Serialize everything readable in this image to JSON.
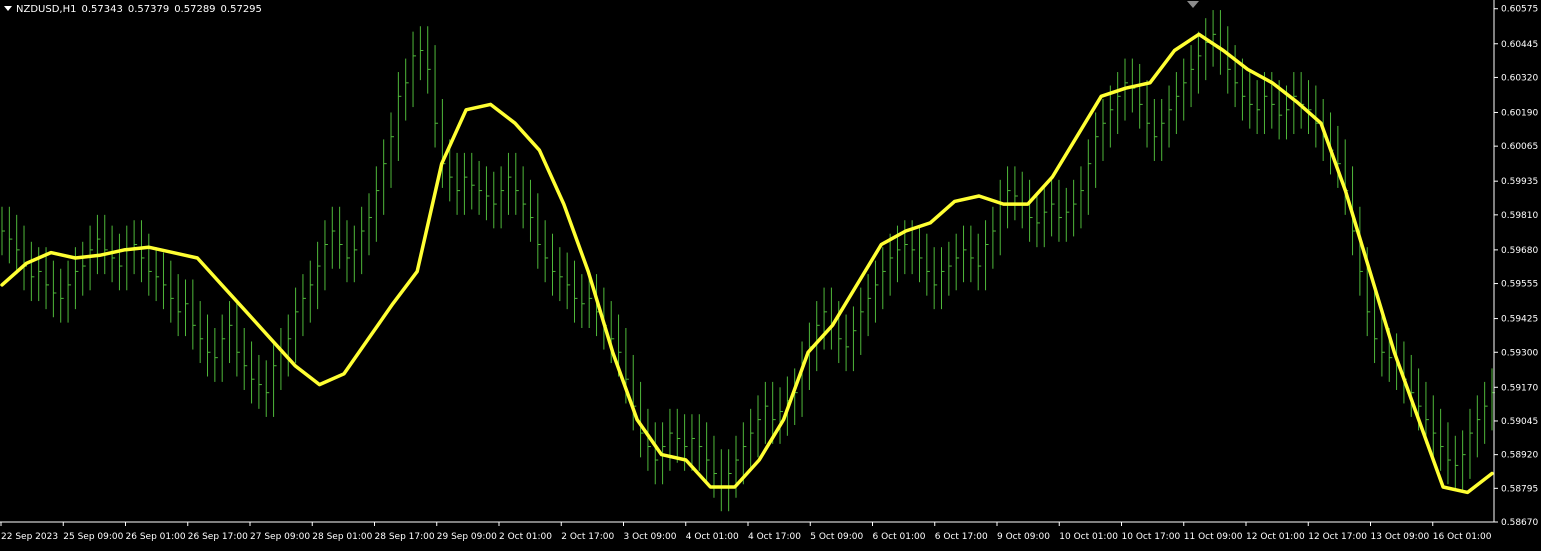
{
  "header": {
    "symbol": "NZDUSD,H1",
    "open": "0.57343",
    "high": "0.57379",
    "low": "0.57289",
    "close": "0.57295"
  },
  "colors": {
    "background": "#000000",
    "bars": "#4fb83a",
    "ma_line": "#ffff33",
    "axis": "#ffffff",
    "marker": "#8c8c8c"
  },
  "chart_data": {
    "type": "line",
    "ylim": [
      0.5867,
      0.606
    ],
    "y_ticks": [
      "0.60575",
      "0.60445",
      "0.60320",
      "0.60190",
      "0.60065",
      "0.59935",
      "0.59810",
      "0.59680",
      "0.59555",
      "0.59425",
      "0.59300",
      "0.59170",
      "0.59045",
      "0.58920",
      "0.58795",
      "0.58670"
    ],
    "x_ticks": [
      "22 Sep 2023",
      "25 Sep 09:00",
      "26 Sep 01:00",
      "26 Sep 17:00",
      "27 Sep 09:00",
      "28 Sep 01:00",
      "28 Sep 17:00",
      "29 Sep 09:00",
      "2 Oct 01:00",
      "2 Oct 17:00",
      "3 Oct 09:00",
      "4 Oct 01:00",
      "4 Oct 17:00",
      "5 Oct 09:00",
      "6 Oct 01:00",
      "6 Oct 17:00",
      "9 Oct 09:00",
      "10 Oct 01:00",
      "10 Oct 17:00",
      "11 Oct 09:00",
      "12 Oct 01:00",
      "12 Oct 17:00",
      "13 Oct 09:00",
      "16 Oct 01:00"
    ],
    "bar_width": 2,
    "series": [
      {
        "kind": "price",
        "x_step": 1,
        "values": [
          0.5975,
          0.5972,
          0.5968,
          0.5962,
          0.5958,
          0.596,
          0.5955,
          0.5952,
          0.595,
          0.5955,
          0.596,
          0.5962,
          0.5968,
          0.5972,
          0.5968,
          0.5965,
          0.5962,
          0.5968,
          0.597,
          0.5965,
          0.596,
          0.5958,
          0.5955,
          0.595,
          0.5945,
          0.5948,
          0.594,
          0.5935,
          0.593,
          0.5928,
          0.5935,
          0.594,
          0.593,
          0.5925,
          0.592,
          0.5918,
          0.5915,
          0.5925,
          0.593,
          0.5935,
          0.5945,
          0.595,
          0.5955,
          0.5962,
          0.597,
          0.5975,
          0.597,
          0.5965,
          0.5968,
          0.5975,
          0.598,
          0.599,
          0.6,
          0.601,
          0.6025,
          0.603,
          0.604,
          0.6042,
          0.6035,
          0.6015,
          0.6,
          0.5995,
          0.599,
          0.5995,
          0.5992,
          0.599,
          0.5988,
          0.5985,
          0.599,
          0.5995,
          0.599,
          0.5985,
          0.598,
          0.597,
          0.5965,
          0.596,
          0.5958,
          0.5955,
          0.595,
          0.5948,
          0.595,
          0.5945,
          0.594,
          0.5935,
          0.593,
          0.592,
          0.591,
          0.59,
          0.5895,
          0.589,
          0.5895,
          0.59,
          0.5898,
          0.5895,
          0.5898,
          0.5895,
          0.589,
          0.5885,
          0.588,
          0.5885,
          0.589,
          0.5895,
          0.59,
          0.5905,
          0.591,
          0.5905,
          0.5908,
          0.5912,
          0.5915,
          0.5925,
          0.5932,
          0.594,
          0.5945,
          0.594,
          0.5935,
          0.5932,
          0.5938,
          0.5945,
          0.595,
          0.5955,
          0.596,
          0.5965,
          0.5968,
          0.597,
          0.5968,
          0.5965,
          0.596,
          0.5955,
          0.596,
          0.5962,
          0.5965,
          0.5968,
          0.5965,
          0.5962,
          0.597,
          0.5975,
          0.5985,
          0.599,
          0.5988,
          0.5985,
          0.598,
          0.5978,
          0.5982,
          0.5985,
          0.598,
          0.5982,
          0.5985,
          0.599,
          0.6,
          0.601,
          0.6015,
          0.602,
          0.6025,
          0.603,
          0.6028,
          0.6022,
          0.6015,
          0.601,
          0.6015,
          0.602,
          0.6025,
          0.603,
          0.6035,
          0.604,
          0.6045,
          0.6048,
          0.6042,
          0.6035,
          0.603,
          0.6025,
          0.6022,
          0.602,
          0.6025,
          0.6022,
          0.6018,
          0.602,
          0.6025,
          0.6022,
          0.602,
          0.6015,
          0.601,
          0.6005,
          0.6,
          0.599,
          0.5975,
          0.596,
          0.5945,
          0.5935,
          0.593,
          0.5928,
          0.5925,
          0.592,
          0.5915,
          0.591,
          0.5905,
          0.59,
          0.5895,
          0.589,
          0.5888,
          0.5892,
          0.59,
          0.5905,
          0.591,
          0.5915
        ]
      },
      {
        "kind": "moving-average",
        "values": [
          0.5955,
          0.5963,
          0.5967,
          0.5965,
          0.5966,
          0.5968,
          0.5969,
          0.5967,
          0.5965,
          0.5955,
          0.5945,
          0.5935,
          0.5925,
          0.5918,
          0.5922,
          0.5935,
          0.5948,
          0.596,
          0.6,
          0.602,
          0.6022,
          0.6015,
          0.6005,
          0.5985,
          0.596,
          0.593,
          0.5905,
          0.5892,
          0.589,
          0.588,
          0.588,
          0.589,
          0.5905,
          0.593,
          0.594,
          0.5955,
          0.597,
          0.5975,
          0.5978,
          0.5986,
          0.5988,
          0.5985,
          0.5985,
          0.5995,
          0.601,
          0.6025,
          0.6028,
          0.603,
          0.6042,
          0.6048,
          0.6042,
          0.6035,
          0.603,
          0.6023,
          0.6015,
          0.599,
          0.596,
          0.593,
          0.5905,
          0.588,
          0.5878,
          0.5885
        ]
      }
    ]
  }
}
